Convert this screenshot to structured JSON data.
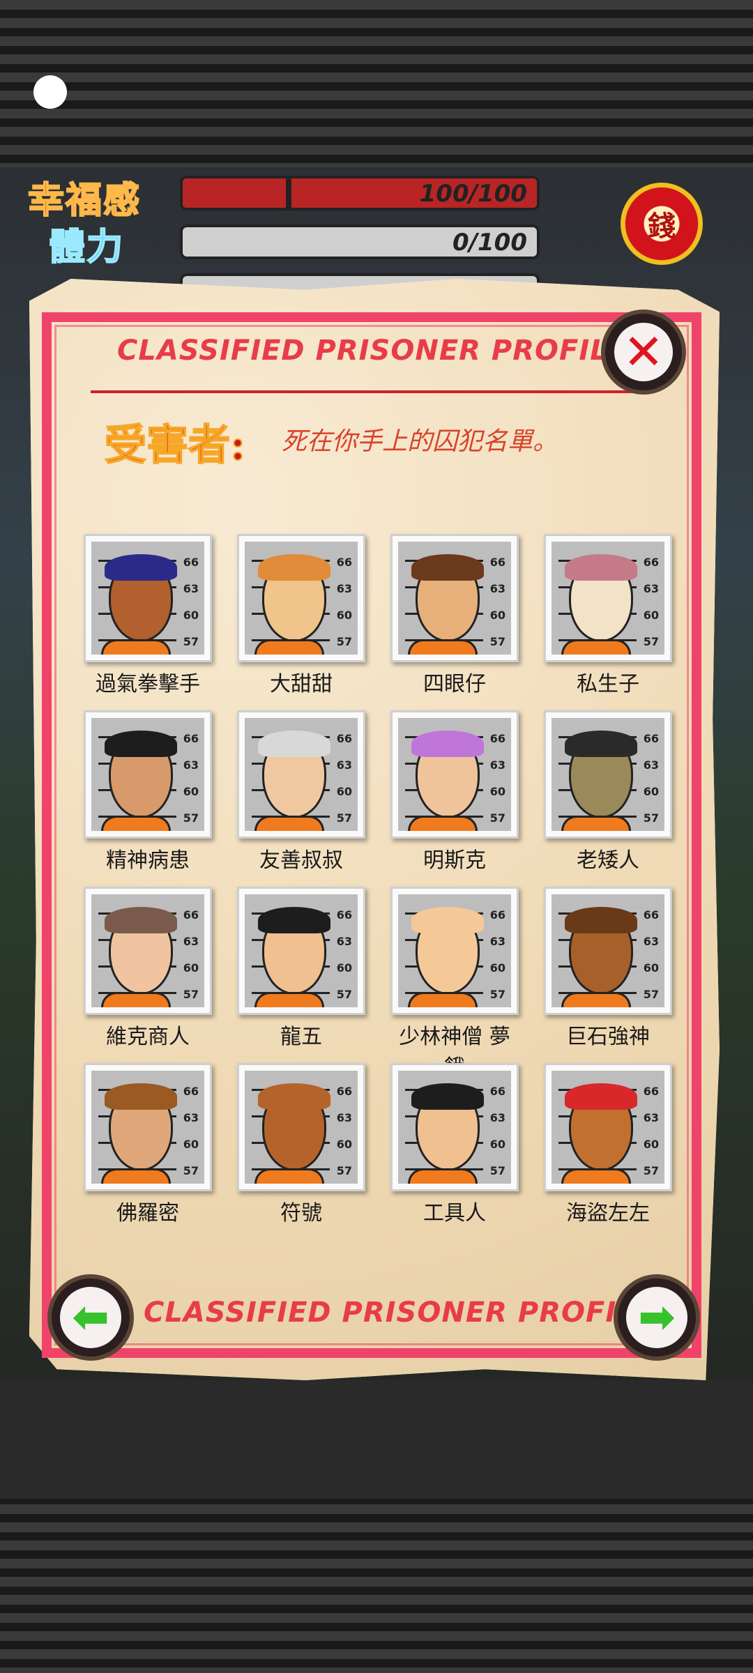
{
  "hud": {
    "happiness_label": "幸福感",
    "stamina_label": "體力",
    "happiness_value": "100/100",
    "happiness_fraction": 1.0,
    "stamina_value": "0/100",
    "stamina_fraction": 0.0,
    "money_icon": "錢"
  },
  "panel": {
    "title": "CLASSIFIED PRISONER PROFILE",
    "victims_label": "受害者:",
    "victims_description": "死在你手上的囚犯名單。",
    "footer_title": "CLASSIFIED PRISONER PROFILE",
    "close_icon": "close-icon",
    "prev_icon": "arrow-left-icon",
    "next_icon": "arrow-right-icon"
  },
  "mugshot_numbers": [
    "66",
    "63",
    "60",
    "57"
  ],
  "prisoners": [
    {
      "name": "過氣拳擊手",
      "skin": "#b2602d",
      "hair": "#2b2a8a"
    },
    {
      "name": "大甜甜",
      "skin": "#f0c48a",
      "hair": "#e08c3a"
    },
    {
      "name": "四眼仔",
      "skin": "#e7b07a",
      "hair": "#6b3a1c"
    },
    {
      "name": "私生子",
      "skin": "#f1e2c8",
      "hair": "#c57a87"
    },
    {
      "name": "精神病患",
      "skin": "#d89a6a",
      "hair": "#1d1d1d"
    },
    {
      "name": "友善叔叔",
      "skin": "#f0c8a0",
      "hair": "#d8d8d8"
    },
    {
      "name": "明斯克",
      "skin": "#f0c49a",
      "hair": "#c075d8"
    },
    {
      "name": "老矮人",
      "skin": "#9a8a5a",
      "hair": "#2a2a2a"
    },
    {
      "name": "維克商人",
      "skin": "#f0c4a0",
      "hair": "#7a5a4a"
    },
    {
      "name": "龍五",
      "skin": "#f0c090",
      "hair": "#1d1d1d"
    },
    {
      "name": "少林神僧 夢餓",
      "skin": "#f5c898",
      "hair": "#f5c898"
    },
    {
      "name": "巨石強神",
      "skin": "#a8602a",
      "hair": "#6a3a18"
    },
    {
      "name": "佛羅密",
      "skin": "#e0a87a",
      "hair": "#9a5a22"
    },
    {
      "name": "符號",
      "skin": "#b4642a",
      "hair": "#b4642a"
    },
    {
      "name": "工具人",
      "skin": "#f0c090",
      "hair": "#1d1d1d"
    },
    {
      "name": "海盜左左",
      "skin": "#c27030",
      "hair": "#d8282a"
    }
  ]
}
